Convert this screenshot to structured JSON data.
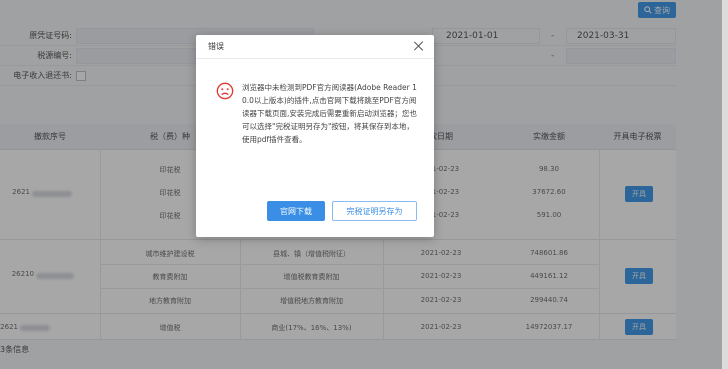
{
  "toolbar": {
    "search_label": "查询"
  },
  "form": {
    "voucher_label": "原凭证号码:",
    "tax_no_label": "税源编号:",
    "electronic_label": "电子收入退还书:",
    "date_from": "2021-01-01",
    "date_to": "2021-03-31",
    "dash": "-"
  },
  "table": {
    "headers": {
      "serial": "撤款序号",
      "tax_type": "税（费）种",
      "date": "款日期",
      "amount": "实缴金额",
      "issue": "开具电子税票"
    },
    "groups": [
      {
        "serial": "2621",
        "rows": [
          {
            "tax": "印花税",
            "item": "",
            "date": "021-02-23",
            "amount": "98.30"
          },
          {
            "tax": "印花税",
            "item": "",
            "date": "021-02-23",
            "amount": "37672.60"
          },
          {
            "tax": "印花税",
            "item": "",
            "date": "021-02-23",
            "amount": "591.00"
          }
        ],
        "button": "开具"
      },
      {
        "serial": "26210",
        "rows": [
          {
            "tax": "城市维护建设税",
            "item": "县城、镇（增值税附征）",
            "date": "2021-02-23",
            "amount": "748601.86"
          },
          {
            "tax": "教育费附加",
            "item": "增值税教育费附加",
            "date": "2021-02-23",
            "amount": "449161.12"
          },
          {
            "tax": "地方教育附加",
            "item": "增值税地方教育附加",
            "date": "2021-02-23",
            "amount": "299440.74"
          }
        ],
        "button": "开具"
      },
      {
        "serial": "2621",
        "rows": [
          {
            "tax": "增值税",
            "item": "商业(17%、16%、13%)",
            "date": "2021-02-23",
            "amount": "14972037.17"
          }
        ],
        "button": "开具"
      }
    ]
  },
  "footer": {
    "note": "3条信息"
  },
  "dialog": {
    "title": "错误",
    "message": "浏览器中未检测到PDF官方阅读器(Adobe Reader 10.0以上版本)的插件,点击官网下载将跳至PDF官方阅读器下载页面,安装完成后需要重新启动浏览器；您也可以选择\"完税证明另存为\"按钮，将其保存到本地，使用pdf插件查看。",
    "primary_button": "官网下载",
    "secondary_button": "完税证明另存为"
  }
}
